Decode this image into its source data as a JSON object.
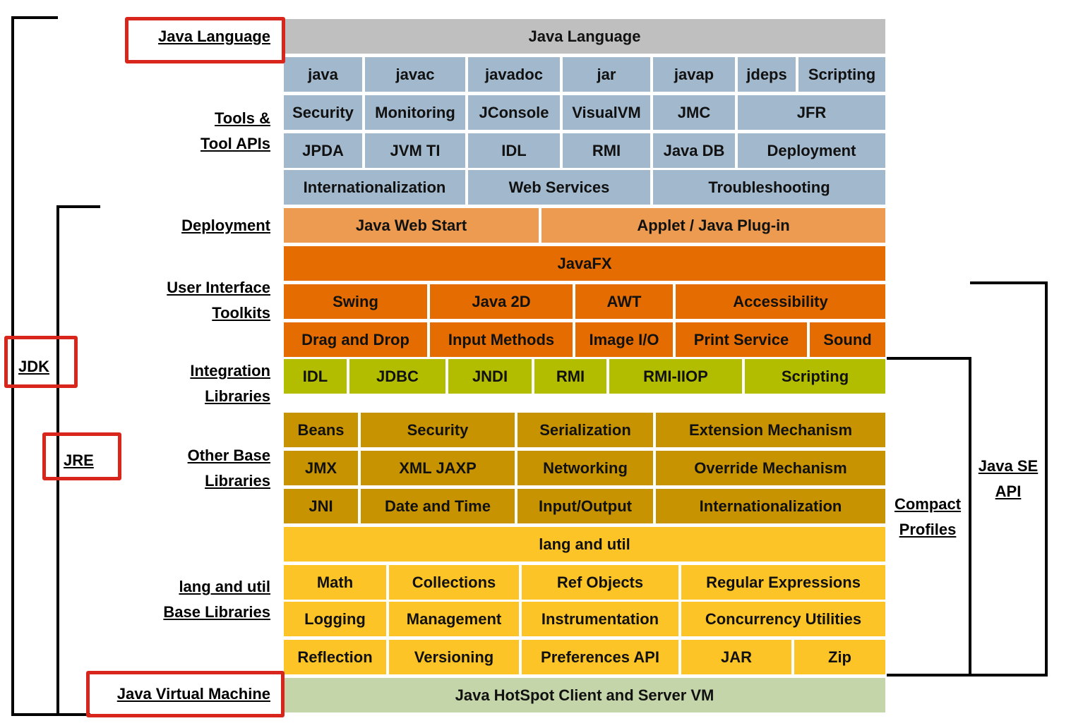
{
  "colors": {
    "java_language": "#bfbfbf",
    "tools": "#a2b8cc",
    "deployment": "#ec9b50",
    "ui_toolkits": "#e46c00",
    "integration": "#b2bd00",
    "other_base": "#c89300",
    "lang_util": "#fdc427",
    "jvm": "#c5d5aa",
    "highlight": "#d9261c"
  },
  "left_labels": {
    "java_language": "Java Language",
    "tools_1": "Tools &",
    "tools_2": "Tool APIs",
    "deployment": "Deployment",
    "ui_1": "User Interface",
    "ui_2": "Toolkits",
    "integration_1": "Integration",
    "integration_2": "Libraries",
    "other_1": "Other Base",
    "other_2": "Libraries",
    "lang_1": "lang and util",
    "lang_2": "Base Libraries",
    "jvm": "Java Virtual Machine"
  },
  "brackets": {
    "jdk": "JDK",
    "jre": "JRE",
    "compact_1": "Compact",
    "compact_2": "Profiles",
    "javase_1": "Java SE",
    "javase_2": "API"
  },
  "rows": [
    {
      "group": "java_language",
      "cells": [
        "Java Language"
      ]
    },
    {
      "group": "tools",
      "cells": [
        "java",
        "javac",
        "javadoc",
        "jar",
        "javap",
        "jdeps",
        "Scripting"
      ]
    },
    {
      "group": "tools",
      "cells": [
        "Security",
        "Monitoring",
        "JConsole",
        "VisualVM",
        "JMC",
        "JFR"
      ]
    },
    {
      "group": "tools",
      "cells": [
        "JPDA",
        "JVM TI",
        "IDL",
        "RMI",
        "Java DB",
        "Deployment"
      ]
    },
    {
      "group": "tools",
      "cells": [
        "Internationalization",
        "Web Services",
        "Troubleshooting"
      ]
    },
    {
      "group": "deployment",
      "cells": [
        "Java Web Start",
        "Applet / Java Plug-in"
      ]
    },
    {
      "group": "ui_toolkits",
      "cells": [
        "JavaFX"
      ]
    },
    {
      "group": "ui_toolkits",
      "cells": [
        "Swing",
        "Java 2D",
        "AWT",
        "Accessibility"
      ]
    },
    {
      "group": "ui_toolkits",
      "cells": [
        "Drag and Drop",
        "Input Methods",
        "Image I/O",
        "Print Service",
        "Sound"
      ]
    },
    {
      "group": "integration",
      "cells": [
        "IDL",
        "JDBC",
        "JNDI",
        "RMI",
        "RMI-IIOP",
        "Scripting"
      ]
    },
    {
      "group": "other_base",
      "cells": [
        "Beans",
        "Security",
        "Serialization",
        "Extension Mechanism"
      ]
    },
    {
      "group": "other_base",
      "cells": [
        "JMX",
        "XML JAXP",
        "Networking",
        "Override Mechanism"
      ]
    },
    {
      "group": "other_base",
      "cells": [
        "JNI",
        "Date and Time",
        "Input/Output",
        "Internationalization"
      ]
    },
    {
      "group": "lang_util",
      "cells": [
        "lang and util"
      ]
    },
    {
      "group": "lang_util",
      "cells": [
        "Math",
        "Collections",
        "Ref Objects",
        "Regular Expressions"
      ]
    },
    {
      "group": "lang_util",
      "cells": [
        "Logging",
        "Management",
        "Instrumentation",
        "Concurrency Utilities"
      ]
    },
    {
      "group": "lang_util",
      "cells": [
        "Reflection",
        "Versioning",
        "Preferences API",
        "JAR",
        "Zip"
      ]
    },
    {
      "group": "jvm",
      "cells": [
        "Java HotSpot Client and Server VM"
      ]
    }
  ]
}
